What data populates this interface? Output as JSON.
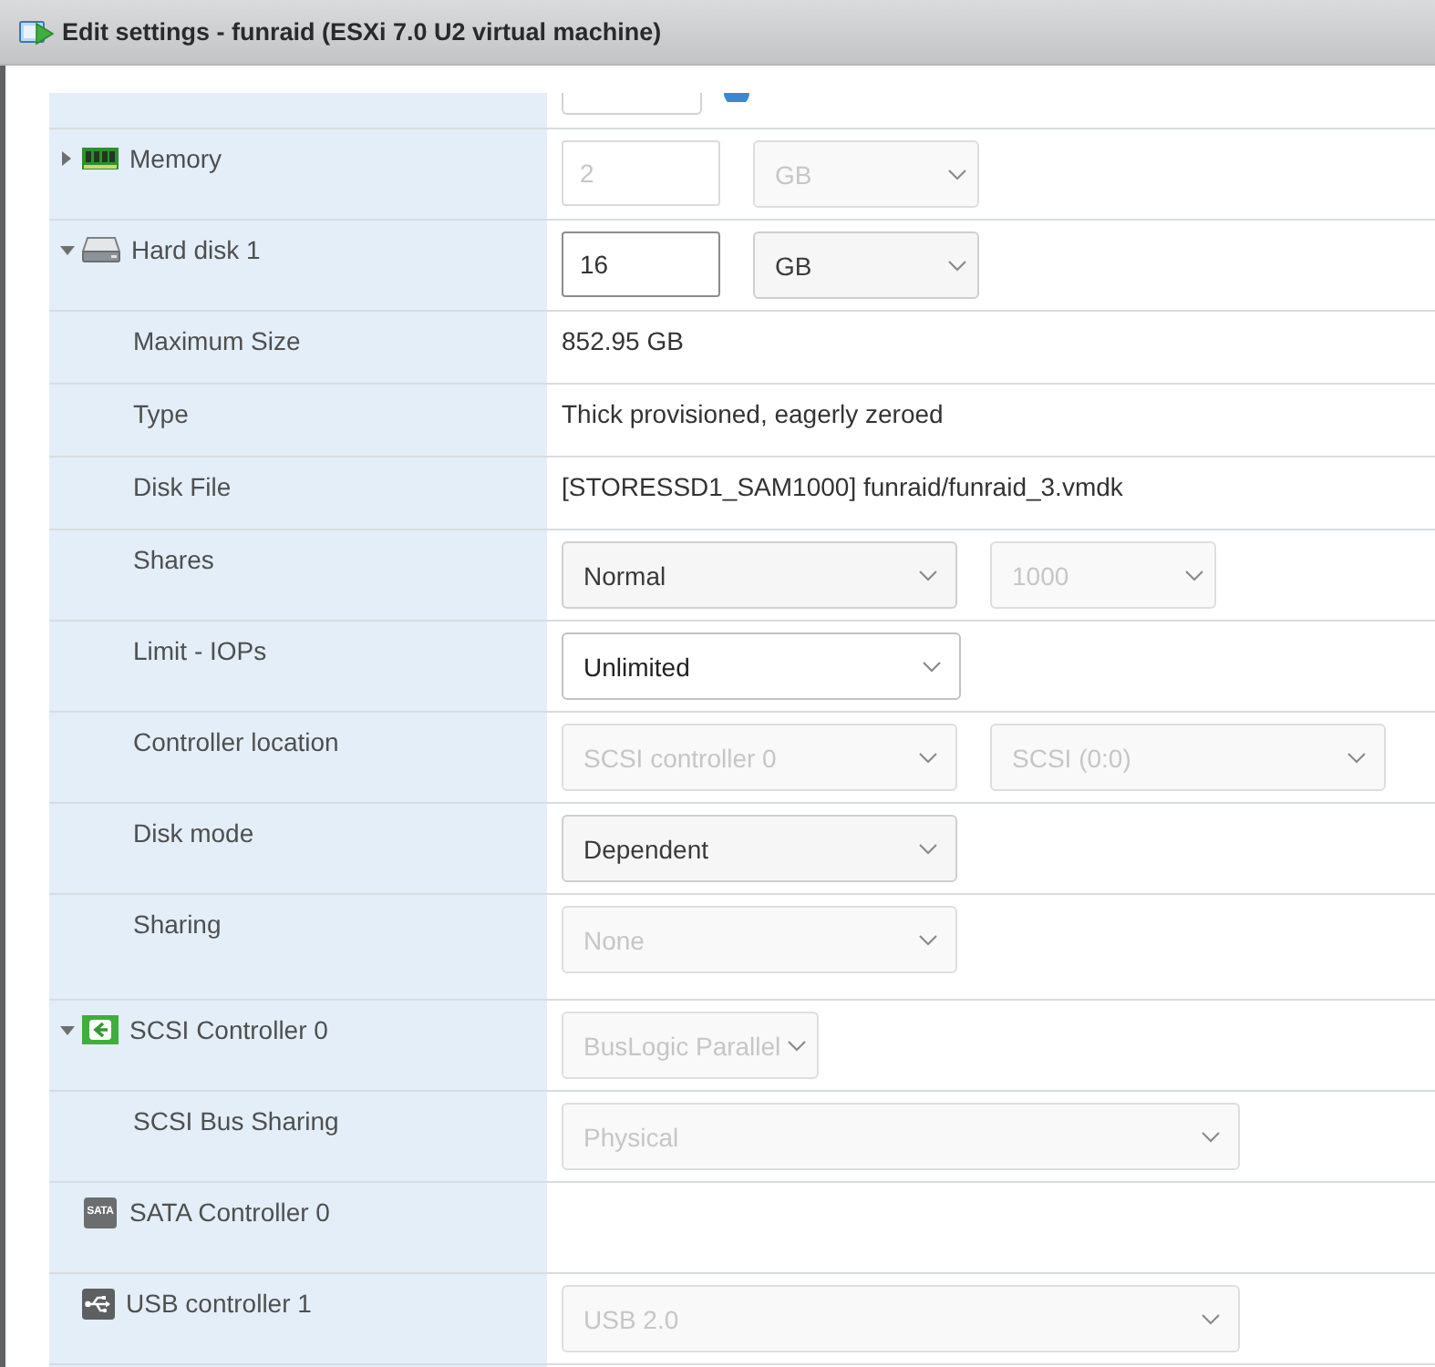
{
  "window": {
    "title": "Edit settings - funraid (ESXi 7.0 U2 virtual machine)"
  },
  "devices": [
    {
      "label": "Memory",
      "kind": "memory",
      "expanded": false,
      "controls": [
        {
          "kind": "number",
          "value": "2",
          "disabled": true
        },
        {
          "kind": "compact",
          "value": "GB",
          "disabled": true
        }
      ]
    },
    {
      "label": "Hard disk 1",
      "kind": "disk",
      "expanded": true,
      "controls": [
        {
          "kind": "number",
          "value": "16",
          "disabled": false
        },
        {
          "kind": "compact",
          "value": "GB",
          "disabled": false
        }
      ],
      "children": [
        {
          "label": "Maximum Size",
          "text": "852.95 GB"
        },
        {
          "label": "Type",
          "text": "Thick provisioned, eagerly zeroed"
        },
        {
          "label": "Disk File",
          "text": "[STORESSD1_SAM1000] funraid/funraid_3.vmdk"
        },
        {
          "label": "Shares",
          "controls": [
            {
              "kind": "dropdown",
              "value": "Normal",
              "disabled": false
            },
            {
              "kind": "compact",
              "value": "1000",
              "disabled": true
            }
          ]
        },
        {
          "label": "Limit - IOPs",
          "controls": [
            {
              "kind": "combo",
              "value": "Unlimited",
              "disabled": false
            }
          ]
        },
        {
          "label": "Controller location",
          "controls": [
            {
              "kind": "dropdown",
              "value": "SCSI controller 0",
              "disabled": true
            },
            {
              "kind": "dropdown",
              "value": "SCSI (0:0)",
              "disabled": true
            }
          ]
        },
        {
          "label": "Disk mode",
          "controls": [
            {
              "kind": "dropdown",
              "value": "Dependent",
              "disabled": false
            }
          ]
        },
        {
          "label": "Sharing",
          "controls": [
            {
              "kind": "dropdown",
              "value": "None",
              "disabled": true
            }
          ]
        }
      ]
    },
    {
      "label": "SCSI Controller 0",
      "kind": "scsi",
      "expanded": true,
      "controls": [
        {
          "kind": "compact",
          "value": "BusLogic Parallel",
          "disabled": true
        }
      ],
      "children": [
        {
          "label": "SCSI Bus Sharing",
          "controls": [
            {
              "kind": "wide",
              "value": "Physical",
              "disabled": true
            }
          ]
        }
      ]
    },
    {
      "label": "SATA Controller 0",
      "kind": "sata",
      "icon_text": "SATA"
    },
    {
      "label": "USB controller 1",
      "kind": "usb",
      "controls": [
        {
          "kind": "wide",
          "value": "USB 2.0",
          "disabled": true
        }
      ]
    }
  ]
}
